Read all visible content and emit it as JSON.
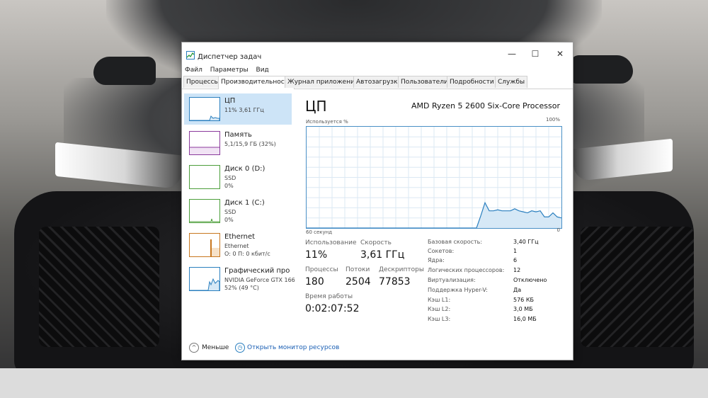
{
  "window": {
    "title": "Диспетчер задач",
    "controls": {
      "minimize": "—",
      "maximize": "☐",
      "close": "✕"
    }
  },
  "menu": [
    "Файл",
    "Параметры",
    "Вид"
  ],
  "tabs": [
    "Процессы",
    "Производительность",
    "Журнал приложений",
    "Автозагрузка",
    "Пользователи",
    "Подробности",
    "Службы"
  ],
  "active_tab": "Производительность",
  "sidebar": [
    {
      "title": "ЦП",
      "line1": "11% 3,61 ГГц",
      "line2": ""
    },
    {
      "title": "Память",
      "line1": "5,1/15,9 ГБ (32%)",
      "line2": ""
    },
    {
      "title": "Диск 0 (D:)",
      "line1": "SSD",
      "line2": "0%"
    },
    {
      "title": "Диск 1 (C:)",
      "line1": "SSD",
      "line2": "0%"
    },
    {
      "title": "Ethernet",
      "line1": "Ethernet",
      "line2": "О: 0 П: 0 кбит/с"
    },
    {
      "title": "Графический про",
      "line1": "NVIDIA GeForce GTX 166",
      "line2": "52% (49 °C)"
    }
  ],
  "cpu": {
    "title": "ЦП",
    "model": "AMD Ryzen 5 2600 Six-Core Processor",
    "utilization_label": "Используется %",
    "max_label": "100%",
    "axis_left": "60 секунд",
    "axis_right": "0",
    "stats": {
      "util_label": "Использование",
      "util_value": "11%",
      "speed_label": "Скорость",
      "speed_value": "3,61 ГГц",
      "processes_label": "Процессы",
      "processes_value": "180",
      "threads_label": "Потоки",
      "threads_value": "2504",
      "handles_label": "Дескрипторы",
      "handles_value": "77853",
      "uptime_label": "Время работы",
      "uptime_value": "0:02:07:52"
    },
    "specs": [
      {
        "label": "Базовая скорость:",
        "value": "3,40 ГГц"
      },
      {
        "label": "Сокетов:",
        "value": "1"
      },
      {
        "label": "Ядра:",
        "value": "6"
      },
      {
        "label": "Логических процессоров:",
        "value": "12"
      },
      {
        "label": "Виртуализация:",
        "value": "Отключено"
      },
      {
        "label": "Поддержка Hyper-V:",
        "value": "Да"
      },
      {
        "label": "Кэш L1:",
        "value": "576 КБ"
      },
      {
        "label": "Кэш L2:",
        "value": "3,0 МБ"
      },
      {
        "label": "Кэш L3:",
        "value": "16,0 МБ"
      }
    ]
  },
  "footer": {
    "fewer": "Меньше",
    "monitor": "Открыть монитор ресурсов"
  },
  "colors": {
    "cpu_line": "#2a7fbf",
    "cpu_fill": "#d6e8f6",
    "grid": "#dbe8f3",
    "selection": "#cde4f7"
  },
  "chart_data": {
    "type": "area",
    "x": [
      0,
      6,
      12,
      18,
      24,
      30,
      36,
      38,
      39,
      40,
      41,
      42,
      43,
      44,
      45,
      46,
      47,
      48,
      49,
      50,
      51,
      52,
      53,
      54,
      55,
      56,
      57,
      58,
      59,
      60
    ],
    "values": [
      0,
      0,
      0,
      0,
      0,
      0,
      0,
      0,
      0,
      0,
      12,
      25,
      17,
      17,
      18,
      17,
      17,
      17,
      19,
      17,
      16,
      15,
      17,
      16,
      17,
      11,
      11,
      15,
      11,
      10
    ],
    "ylim": [
      0,
      100
    ],
    "xlim": [
      0,
      60
    ]
  }
}
